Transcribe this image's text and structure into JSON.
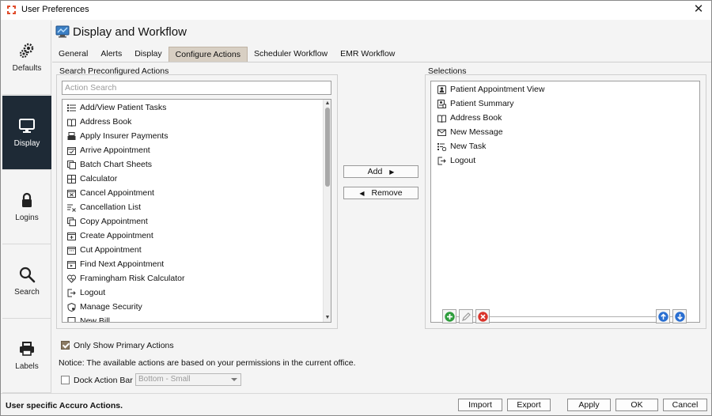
{
  "window": {
    "title": "User Preferences",
    "close_glyph": "✕"
  },
  "nav": {
    "items": [
      {
        "label": "Defaults",
        "icon": "gears-icon"
      },
      {
        "label": "Display",
        "icon": "monitor-icon",
        "active": true
      },
      {
        "label": "Logins",
        "icon": "lock-icon"
      },
      {
        "label": "Search",
        "icon": "magnifier-icon"
      },
      {
        "label": "Labels",
        "icon": "printer-icon"
      }
    ]
  },
  "page": {
    "title": "Display and Workflow"
  },
  "tabs": [
    "General",
    "Alerts",
    "Display",
    "Configure Actions",
    "Scheduler Workflow",
    "EMR Workflow"
  ],
  "active_tab": "Configure Actions",
  "preconfigured": {
    "label": "Search Preconfigured Actions",
    "search_placeholder": "Action Search",
    "items": [
      "Add/View Patient Tasks",
      "Address Book",
      "Apply Insurer Payments",
      "Arrive Appointment",
      "Batch Chart Sheets",
      "Calculator",
      "Cancel Appointment",
      "Cancellation List",
      "Copy Appointment",
      "Create Appointment",
      "Cut Appointment",
      "Find Next Appointment",
      "Framingham Risk Calculator",
      "Logout",
      "Manage Security",
      "New Bill"
    ]
  },
  "actions": {
    "add": "Add",
    "remove": "Remove"
  },
  "selections": {
    "label": "Selections",
    "items": [
      "Patient Appointment View",
      "Patient Summary",
      "Address Book",
      "New Message",
      "New Task",
      "Logout"
    ]
  },
  "options": {
    "primary_only_label": "Only Show Primary Actions",
    "primary_only_checked": true,
    "notice": "Notice: The available actions are based on your permissions in the current office.",
    "dock_label": "Dock Action Bar",
    "dock_checked": false,
    "dock_position": "Bottom - Small"
  },
  "footer": {
    "status": "User specific Accuro Actions.",
    "import": "Import",
    "export": "Export",
    "apply": "Apply",
    "ok": "OK",
    "cancel": "Cancel"
  },
  "colors": {
    "nav_active": "#1e2a36",
    "tab_active": "#d8cfc3",
    "add_green": "#2e9d3c",
    "remove_red": "#d9342b",
    "move_blue": "#2a6fd1"
  }
}
